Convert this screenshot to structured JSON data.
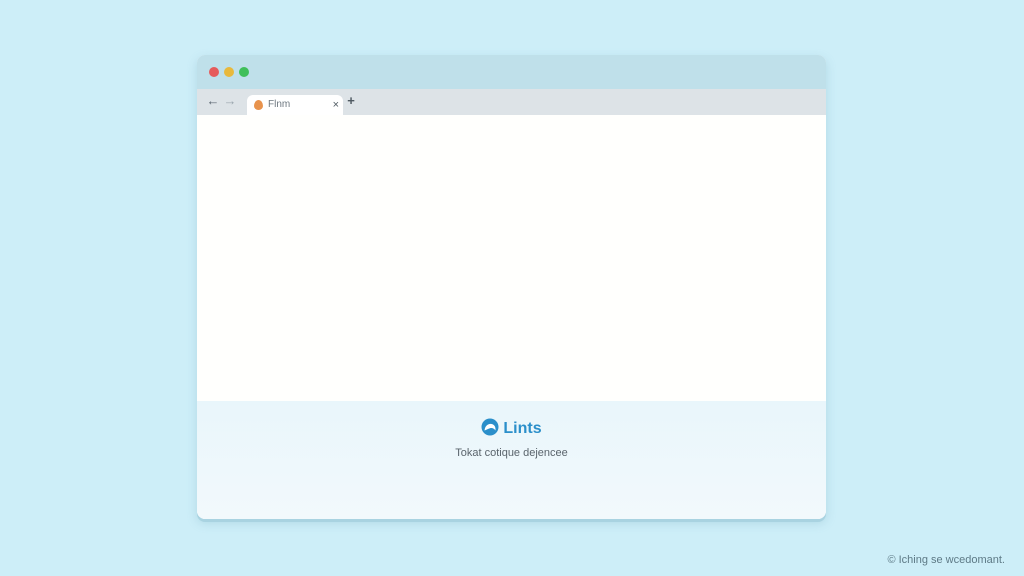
{
  "colors": {
    "background": "#cdeef8",
    "titlebar": "#bfe0ea",
    "tabbar": "#dde3e7",
    "accent": "#2b8fca",
    "traffic_red": "#e55b5b",
    "traffic_yellow": "#e8b93c",
    "traffic_green": "#3fbf5a",
    "favicon": "#e8934d"
  },
  "window": {
    "controls": {
      "close": "red-dot",
      "minimize": "yellow-dot",
      "maximize": "green-dot"
    }
  },
  "toolbar": {
    "back_icon": "←",
    "forward_icon": "→",
    "new_tab_icon": "+"
  },
  "tab": {
    "title": "Flnm",
    "close_icon": "×",
    "favicon": "flame-icon"
  },
  "footer": {
    "brand_name": "Lints",
    "brand_icon": "cloud-logo-icon",
    "tagline": "Tokat cotique dejencee"
  },
  "watermark": {
    "text": "© Iching se wcedomant."
  }
}
